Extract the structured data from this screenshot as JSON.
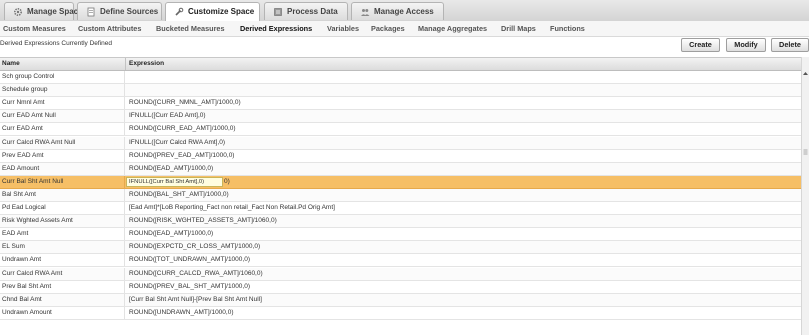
{
  "tabs": [
    {
      "label": "Manage Space",
      "icon": "gear-icon"
    },
    {
      "label": "Define Sources",
      "icon": "document-icon"
    },
    {
      "label": "Customize Space",
      "icon": "wrench-icon"
    },
    {
      "label": "Process Data",
      "icon": "process-icon"
    },
    {
      "label": "Manage Access",
      "icon": "users-icon"
    }
  ],
  "active_tab": "Customize Space",
  "subnav": [
    "Custom Measures",
    "Custom Attributes",
    "Bucketed Measures",
    "Derived Expressions",
    "Variables",
    "Packages",
    "Manage Aggregates",
    "Drill Maps",
    "Functions"
  ],
  "active_subnav": "Derived Expressions",
  "caption": "Derived Expressions Currently Defined",
  "buttons": {
    "create": "Create",
    "modify": "Modify",
    "delete": "Delete"
  },
  "table": {
    "columns": [
      "Name",
      "Expression"
    ],
    "rows": [
      {
        "name": "Sch group Control",
        "expression": ""
      },
      {
        "name": "Schedule group",
        "expression": ""
      },
      {
        "name": "Curr Nmnl Amt",
        "expression": "ROUND([CURR_NMNL_AMT]/1000,0)"
      },
      {
        "name": "Curr EAD Amt Null",
        "expression": "IFNULL([Curr EAD Amt],0)"
      },
      {
        "name": "Curr EAD Amt",
        "expression": "ROUND([CURR_EAD_AMT]/1000,0)"
      },
      {
        "name": "Curr Calcd RWA Amt Null",
        "expression": "IFNULL([Curr Calcd RWA Amt],0)"
      },
      {
        "name": "Prev EAD Amt",
        "expression": "ROUND([PREV_EAD_AMT]/1000,0)"
      },
      {
        "name": "EAD Amount",
        "expression": "ROUND([EAD_AMT]/1000,0)"
      },
      {
        "name": "Curr Bal Sht Amt Null",
        "expression": "IFNULL([Curr Bal Sht Amt],0)",
        "tooltip": "IFNULL([Curr Bal Sht Amt],0)",
        "tail": "0)"
      },
      {
        "name": "Bal Sht Amt",
        "expression": "ROUND([BAL_SHT_AMT]/1000,0)"
      },
      {
        "name": "Pd Ead Logical",
        "expression": "[Ead Amt]*[LoB Reporting_Fact non retail_Fact Non Retail.Pd Orig Amt]"
      },
      {
        "name": "Risk Wghted Assets Amt",
        "expression": "ROUND([RISK_WGHTED_ASSETS_AMT]/1060,0)"
      },
      {
        "name": "EAD Amt",
        "expression": "ROUND([EAD_AMT]/1000,0)"
      },
      {
        "name": "EL Sum",
        "expression": "ROUND([EXPCTD_CR_LOSS_AMT]/1000,0)"
      },
      {
        "name": "Undrawn Amt",
        "expression": "ROUND([TOT_UNDRAWN_AMT]/1000,0)"
      },
      {
        "name": "Curr Calcd RWA Amt",
        "expression": "ROUND([CURR_CALCD_RWA_AMT]/1060,0)"
      },
      {
        "name": "Prev Bal Sht Amt",
        "expression": "ROUND([PREV_BAL_SHT_AMT]/1000,0)"
      },
      {
        "name": "Chnd Bal Amt",
        "expression": "[Curr Bal Sht Amt Null]-[Prev Bal Sht Amt Null]"
      },
      {
        "name": "Undrawn Amount",
        "expression": "ROUND([UNDRAWN_AMT]/1000,0)"
      }
    ],
    "selected_row": "Curr Bal Sht Amt Null"
  },
  "colors": {
    "selection": "#f6bf66",
    "tooltip": "#fffde0"
  }
}
